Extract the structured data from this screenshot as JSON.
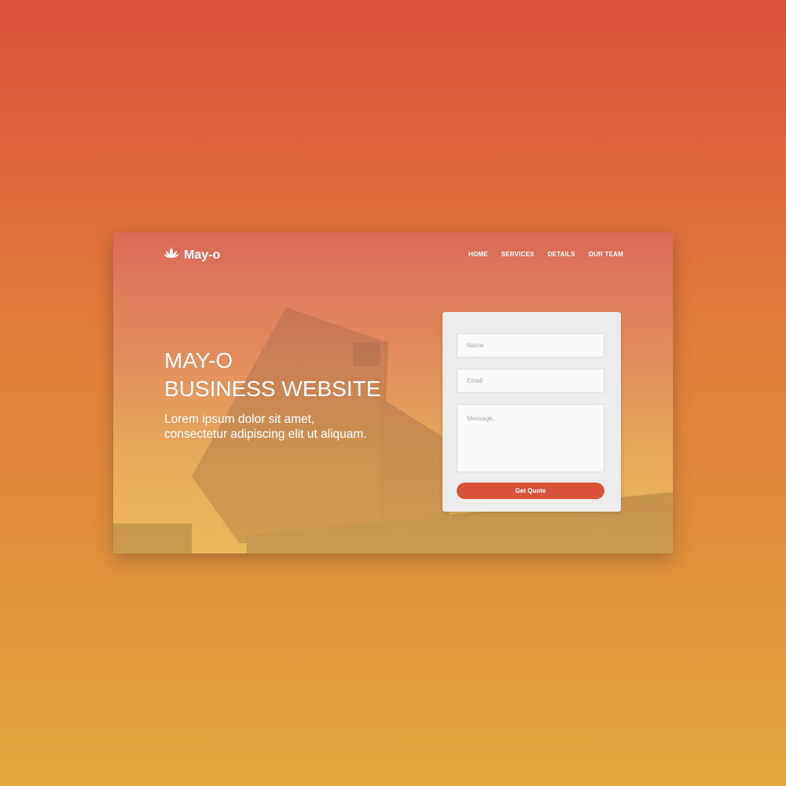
{
  "header": {
    "brand": "May-o",
    "nav": [
      "HOME",
      "SERVICES",
      "DETAILS",
      "OUR TEAM"
    ]
  },
  "hero": {
    "title_line1": "MAY-O",
    "title_line2": "BUSINESS WEBSITE",
    "text": "Lorem ipsum dolor sit amet, consectetur adipiscing elit ut aliquam."
  },
  "form": {
    "name_placeholder": "Name",
    "email_placeholder": "Email",
    "message_placeholder": "Message...",
    "submit_label": "Get Quote"
  },
  "colors": {
    "accent": "#d9533a",
    "bg_top": "#d9533a",
    "bg_bottom": "#e5a640"
  }
}
